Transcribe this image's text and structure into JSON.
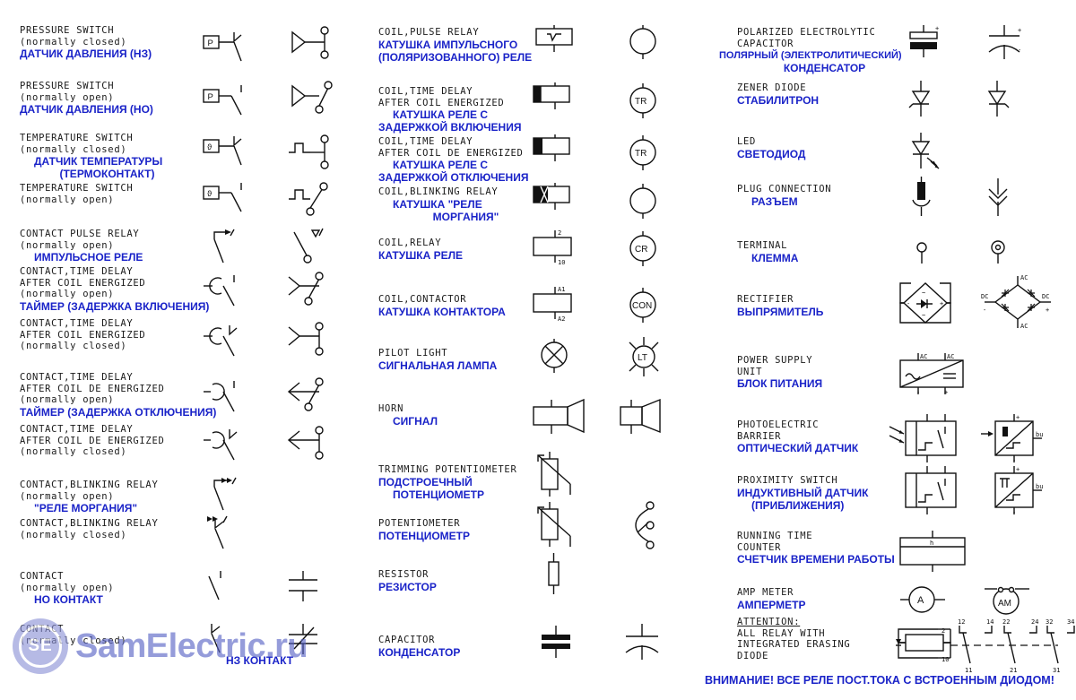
{
  "watermark": {
    "badge": "SE",
    "text": "SamElectric.ru"
  },
  "footer_note": "ВНИМАНИЕ! ВСЕ РЕЛЕ ПОСТ.ТОКА С ВСТРОЕННЫМ ДИОДОМ!",
  "columns": [
    {
      "id": "contacts",
      "rows": [
        {
          "en": [
            "PRESSURE SWITCH",
            "(normally closed)"
          ],
          "ru": [
            "ДАТЧИК ДАВЛЕНИЯ (НЗ)"
          ],
          "symbols": [
            "pressure-switch-nc-box",
            "pressure-switch-nc-alt"
          ]
        },
        {
          "en": [
            "PRESSURE SWITCH",
            "(normally open)"
          ],
          "ru": [
            "ДАТЧИК ДАВЛЕНИЯ (НО)"
          ],
          "symbols": [
            "pressure-switch-no-box",
            "pressure-switch-no-alt"
          ]
        },
        {
          "en": [
            "TEMPERATURE SWITCH",
            "(normally closed)"
          ],
          "ru": [
            "ДАТЧИК ТЕМПЕРАТУРЫ",
            "(ТЕРМОКОНТАКТ)"
          ],
          "symbols": [
            "temperature-switch-nc-box",
            "temperature-switch-nc-alt"
          ]
        },
        {
          "en": [
            "TEMPERATURE SWITCH",
            "(normally open)"
          ],
          "ru": [],
          "symbols": [
            "temperature-switch-no-box",
            "temperature-switch-no-alt"
          ]
        },
        {
          "en": [
            "CONTACT PULSE RELAY",
            "(normally open)"
          ],
          "ru": [
            "ИМПУЛЬСНОЕ РЕЛЕ"
          ],
          "symbols": [
            "contact-pulse-relay-no",
            "contact-pulse-relay-no-alt"
          ]
        },
        {
          "en": [
            "CONTACT,TIME DELAY",
            "AFTER COIL ENERGIZED",
            "(normally open)"
          ],
          "ru": [
            "ТАЙМЕР (ЗАДЕРЖКА ВКЛЮЧЕНИЯ)"
          ],
          "symbols": [
            "contact-on-delay-no",
            "contact-on-delay-no-alt"
          ]
        },
        {
          "en": [
            "CONTACT,TIME DELAY",
            "AFTER COIL ENERGIZED",
            "(normally closed)"
          ],
          "ru": [],
          "symbols": [
            "contact-on-delay-nc",
            "contact-on-delay-nc-alt"
          ]
        },
        {
          "en": [
            "CONTACT,TIME DELAY",
            "AFTER COIL DE ENERGIZED",
            "(normally open)"
          ],
          "ru": [
            "ТАЙМЕР (ЗАДЕРЖКА ОТКЛЮЧЕНИЯ)"
          ],
          "symbols": [
            "contact-off-delay-no",
            "contact-off-delay-no-alt"
          ]
        },
        {
          "en": [
            "CONTACT,TIME DELAY",
            "AFTER COIL DE ENERGIZED",
            "(normally closed)"
          ],
          "ru": [],
          "symbols": [
            "contact-off-delay-nc",
            "contact-off-delay-nc-alt"
          ]
        },
        {
          "en": [
            "CONTACT,BLINKING RELAY",
            "(normally open)"
          ],
          "ru": [
            "\"РЕЛЕ МОРГАНИЯ\""
          ],
          "symbols": [
            "contact-blinking-no",
            ""
          ]
        },
        {
          "en": [
            "CONTACT,BLINKING RELAY",
            "(normally closed)"
          ],
          "ru": [],
          "symbols": [
            "contact-blinking-nc",
            ""
          ]
        },
        {
          "en": [
            "CONTACT",
            "(normally open)"
          ],
          "ru": [
            "НО КОНТАКТ"
          ],
          "symbols": [
            "contact-no",
            "contact-no-alt"
          ]
        },
        {
          "en": [
            "CONTACT",
            "(normally closed)"
          ],
          "ru": [
            "НЗ КОНТАКТ"
          ],
          "symbols": [
            "contact-nc",
            "contact-nc-alt"
          ]
        }
      ]
    },
    {
      "id": "coils",
      "rows": [
        {
          "en": [
            "COIL,PULSE RELAY"
          ],
          "ru": [
            "КАТУШКА ИМПУЛЬСНОГО",
            "(ПОЛЯРИЗОВАННОГО) РЕЛЕ"
          ],
          "symbols": [
            "coil-pulse-relay-box",
            "coil-circle-plain"
          ]
        },
        {
          "en": [
            "COIL,TIME DELAY",
            "AFTER COIL ENERGIZED"
          ],
          "ru": [
            "КАТУШКА РЕЛЕ С",
            "ЗАДЕРЖКОЙ ВКЛЮЧЕНИЯ"
          ],
          "symbols": [
            "coil-on-delay-box",
            "coil-circle-tr"
          ]
        },
        {
          "en": [
            "COIL,TIME DELAY",
            "AFTER COIL DE ENERGIZED"
          ],
          "ru": [
            "КАТУШКА РЕЛЕ С",
            "ЗАДЕРЖКОЙ ОТКЛЮЧЕНИЯ"
          ],
          "symbols": [
            "coil-off-delay-box",
            "coil-circle-tr-2"
          ]
        },
        {
          "en": [
            "COIL,BLINKING RELAY"
          ],
          "ru": [
            "КАТУШКА \"РЕЛЕ",
            "МОРГАНИЯ\""
          ],
          "symbols": [
            "coil-blinking-box",
            "coil-circle-plain-2"
          ]
        },
        {
          "en": [
            "COIL,RELAY"
          ],
          "ru": [
            "КАТУШКА РЕЛЕ"
          ],
          "symbols": [
            "coil-relay-box",
            "coil-circle-cr"
          ],
          "terminals": [
            "2",
            "10"
          ]
        },
        {
          "en": [
            "COIL,CONTACTOR"
          ],
          "ru": [
            "КАТУШКА КОНТАКТОРА"
          ],
          "symbols": [
            "coil-contactor-box",
            "coil-circle-con"
          ],
          "terminals": [
            "A1",
            "A2"
          ]
        },
        {
          "en": [
            "PILOT LIGHT"
          ],
          "ru": [
            "СИГНАЛЬНАЯ ЛАМПА"
          ],
          "symbols": [
            "pilot-light-cross",
            "pilot-light-lt"
          ]
        },
        {
          "en": [
            "HORN"
          ],
          "ru": [
            "СИГНАЛ"
          ],
          "symbols": [
            "horn",
            "horn-alt"
          ]
        },
        {
          "en": [
            "TRIMMING POTENTIOMETER"
          ],
          "ru": [
            "ПОДСТРОЕЧНЫЙ",
            "ПОТЕНЦИОМЕТР"
          ],
          "symbols": [
            "trimming-potentiometer",
            ""
          ]
        },
        {
          "en": [
            "POTENTIOMETER"
          ],
          "ru": [
            "ПОТЕНЦИОМЕТР"
          ],
          "symbols": [
            "potentiometer",
            "potentiometer-alt"
          ]
        },
        {
          "en": [
            "RESISTOR"
          ],
          "ru": [
            "РЕЗИСТОР"
          ],
          "symbols": [
            "resistor",
            ""
          ]
        },
        {
          "en": [
            "CAPACITOR"
          ],
          "ru": [
            "КОНДЕНСАТОР"
          ],
          "symbols": [
            "capacitor",
            "capacitor-alt"
          ]
        }
      ]
    },
    {
      "id": "components",
      "rows": [
        {
          "en": [
            "POLARIZED ELECTROLYTIC",
            "CAPACITOR"
          ],
          "ru": [
            "ПОЛЯРНЫЙ (ЭЛЕКТРОЛИТИЧЕСКИЙ)",
            "КОНДЕНСАТОР"
          ],
          "symbols": [
            "electrolytic-capacitor",
            "electrolytic-capacitor-alt"
          ]
        },
        {
          "en": [
            "ZENER DIODE"
          ],
          "ru": [
            "СТАБИЛИТРОН"
          ],
          "symbols": [
            "zener-diode",
            "zener-diode-alt"
          ]
        },
        {
          "en": [
            "LED"
          ],
          "ru": [
            "СВЕТОДИОД"
          ],
          "symbols": [
            "led",
            ""
          ]
        },
        {
          "en": [
            "PLUG CONNECTION"
          ],
          "ru": [
            "РАЗЪЕМ"
          ],
          "symbols": [
            "plug-connection",
            "plug-connection-alt"
          ]
        },
        {
          "en": [
            "TERMINAL"
          ],
          "ru": [
            "КЛЕММА"
          ],
          "symbols": [
            "terminal",
            "terminal-alt"
          ]
        },
        {
          "en": [
            "RECTIFIER"
          ],
          "ru": [
            "ВЫПРЯМИТЕЛЬ"
          ],
          "symbols": [
            "rectifier",
            "rectifier-bridge"
          ]
        },
        {
          "en": [
            "POWER SUPPLY",
            "UNIT"
          ],
          "ru": [
            "БЛОК ПИТАНИЯ"
          ],
          "symbols": [
            "power-supply-unit",
            ""
          ]
        },
        {
          "en": [
            "PHOTOELECTRIC",
            "BARRIER"
          ],
          "ru": [
            "ОПТИЧЕСКИЙ ДАТЧИК"
          ],
          "symbols": [
            "photoelectric-barrier",
            "photoelectric-barrier-alt"
          ]
        },
        {
          "en": [
            "PROXIMITY SWITCH"
          ],
          "ru": [
            "ИНДУКТИВНЫЙ ДАТЧИК",
            "(ПРИБЛИЖЕНИЯ)"
          ],
          "symbols": [
            "proximity-switch",
            "proximity-switch-alt"
          ]
        },
        {
          "en": [
            "RUNNING TIME",
            "COUNTER"
          ],
          "ru": [
            "СЧЕТЧИК ВРЕМЕНИ РАБОТЫ"
          ],
          "symbols": [
            "running-time-counter",
            ""
          ]
        },
        {
          "en": [
            "AMP METER"
          ],
          "ru": [
            "АМПЕРМЕТР"
          ],
          "symbols": [
            "amp-meter",
            "amp-meter-alt"
          ]
        },
        {
          "en": [
            "ATTENTION:",
            "ALL RELAY WITH",
            "INTEGRATED ERASING",
            "DIODE"
          ],
          "ru": [],
          "symbols": [
            "relay-with-diode-diagram",
            ""
          ],
          "terminals": [
            "2",
            "10",
            "12",
            "14",
            "22",
            "24",
            "32",
            "34",
            "11",
            "21",
            "31"
          ]
        }
      ]
    }
  ],
  "symbol_marks": {
    "pressure_p": "P",
    "temperature_theta": "ϑ",
    "coil_tr": "TR",
    "coil_cr": "CR",
    "coil_con": "CON",
    "pilot_lt": "LT",
    "amp_a": "A",
    "amp_am": "AM",
    "counter_h": "h",
    "ac": "AC",
    "dc": "DC",
    "plus": "+",
    "minus": "-",
    "bu": "bu"
  },
  "colors": {
    "russian_text": "#1a23c8",
    "english_text": "#1a1a1a",
    "symbol_stroke": "#111111",
    "watermark": "#5560c4",
    "background": "#ffffff"
  }
}
